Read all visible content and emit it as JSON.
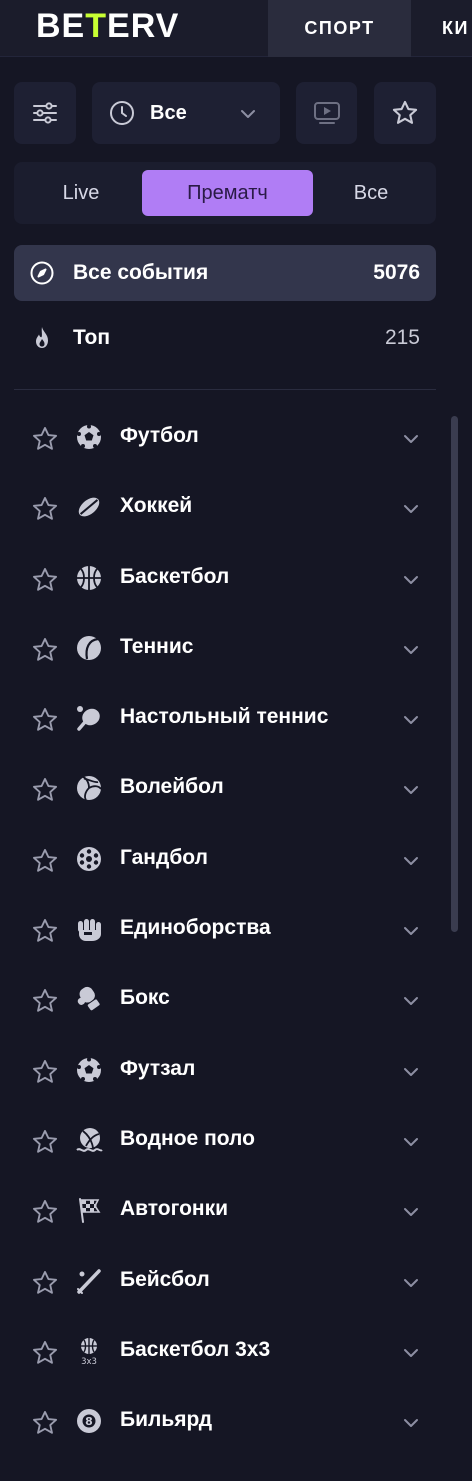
{
  "header": {
    "logo_left": "BE",
    "logo_mark": "T",
    "logo_right": "ERV",
    "nav": [
      {
        "label": "СПОРТ",
        "active": true
      },
      {
        "label": "КИ",
        "active": false
      }
    ]
  },
  "controls": {
    "filter_icon": "sliders-icon",
    "time_select": {
      "icon": "clock-icon",
      "value": "Все",
      "chevron": "chevron-down-icon"
    },
    "video_icon": "video-icon",
    "favorites_icon": "star-icon"
  },
  "segment": {
    "tabs": [
      {
        "label": "Live",
        "active": false
      },
      {
        "label": "Прематч",
        "active": true
      },
      {
        "label": "Все",
        "active": false
      }
    ]
  },
  "main_items": [
    {
      "label": "Все события",
      "count": "5076",
      "icon": "compass-icon",
      "active": true
    },
    {
      "label": "Топ",
      "count": "215",
      "icon": "flame-icon",
      "active": false
    }
  ],
  "sports": [
    {
      "name": "Футбол",
      "icon": "football-icon"
    },
    {
      "name": "Хоккей",
      "icon": "hockey-puck-icon"
    },
    {
      "name": "Баскетбол",
      "icon": "basketball-icon"
    },
    {
      "name": "Теннис",
      "icon": "tennis-ball-icon"
    },
    {
      "name": "Настольный теннис",
      "icon": "table-tennis-icon"
    },
    {
      "name": "Волейбол",
      "icon": "volleyball-icon"
    },
    {
      "name": "Гандбол",
      "icon": "handball-icon"
    },
    {
      "name": "Единоборства",
      "icon": "fist-icon"
    },
    {
      "name": "Бокс",
      "icon": "boxing-glove-icon"
    },
    {
      "name": "Футзал",
      "icon": "futsal-icon"
    },
    {
      "name": "Водное поло",
      "icon": "water-polo-icon"
    },
    {
      "name": "Автогонки",
      "icon": "checkered-flag-icon"
    },
    {
      "name": "Бейсбол",
      "icon": "baseball-bat-icon"
    },
    {
      "name": "Баскетбол 3x3",
      "icon": "basketball-3x3-icon",
      "icon_text": "3x3"
    },
    {
      "name": "Бильярд",
      "icon": "billiard-ball-icon",
      "icon_text": "8"
    }
  ],
  "colors": {
    "background": "#151624",
    "accent_purple": "#b07df5",
    "logo_mark": "#c8ff33",
    "active_row": "#33364c"
  }
}
